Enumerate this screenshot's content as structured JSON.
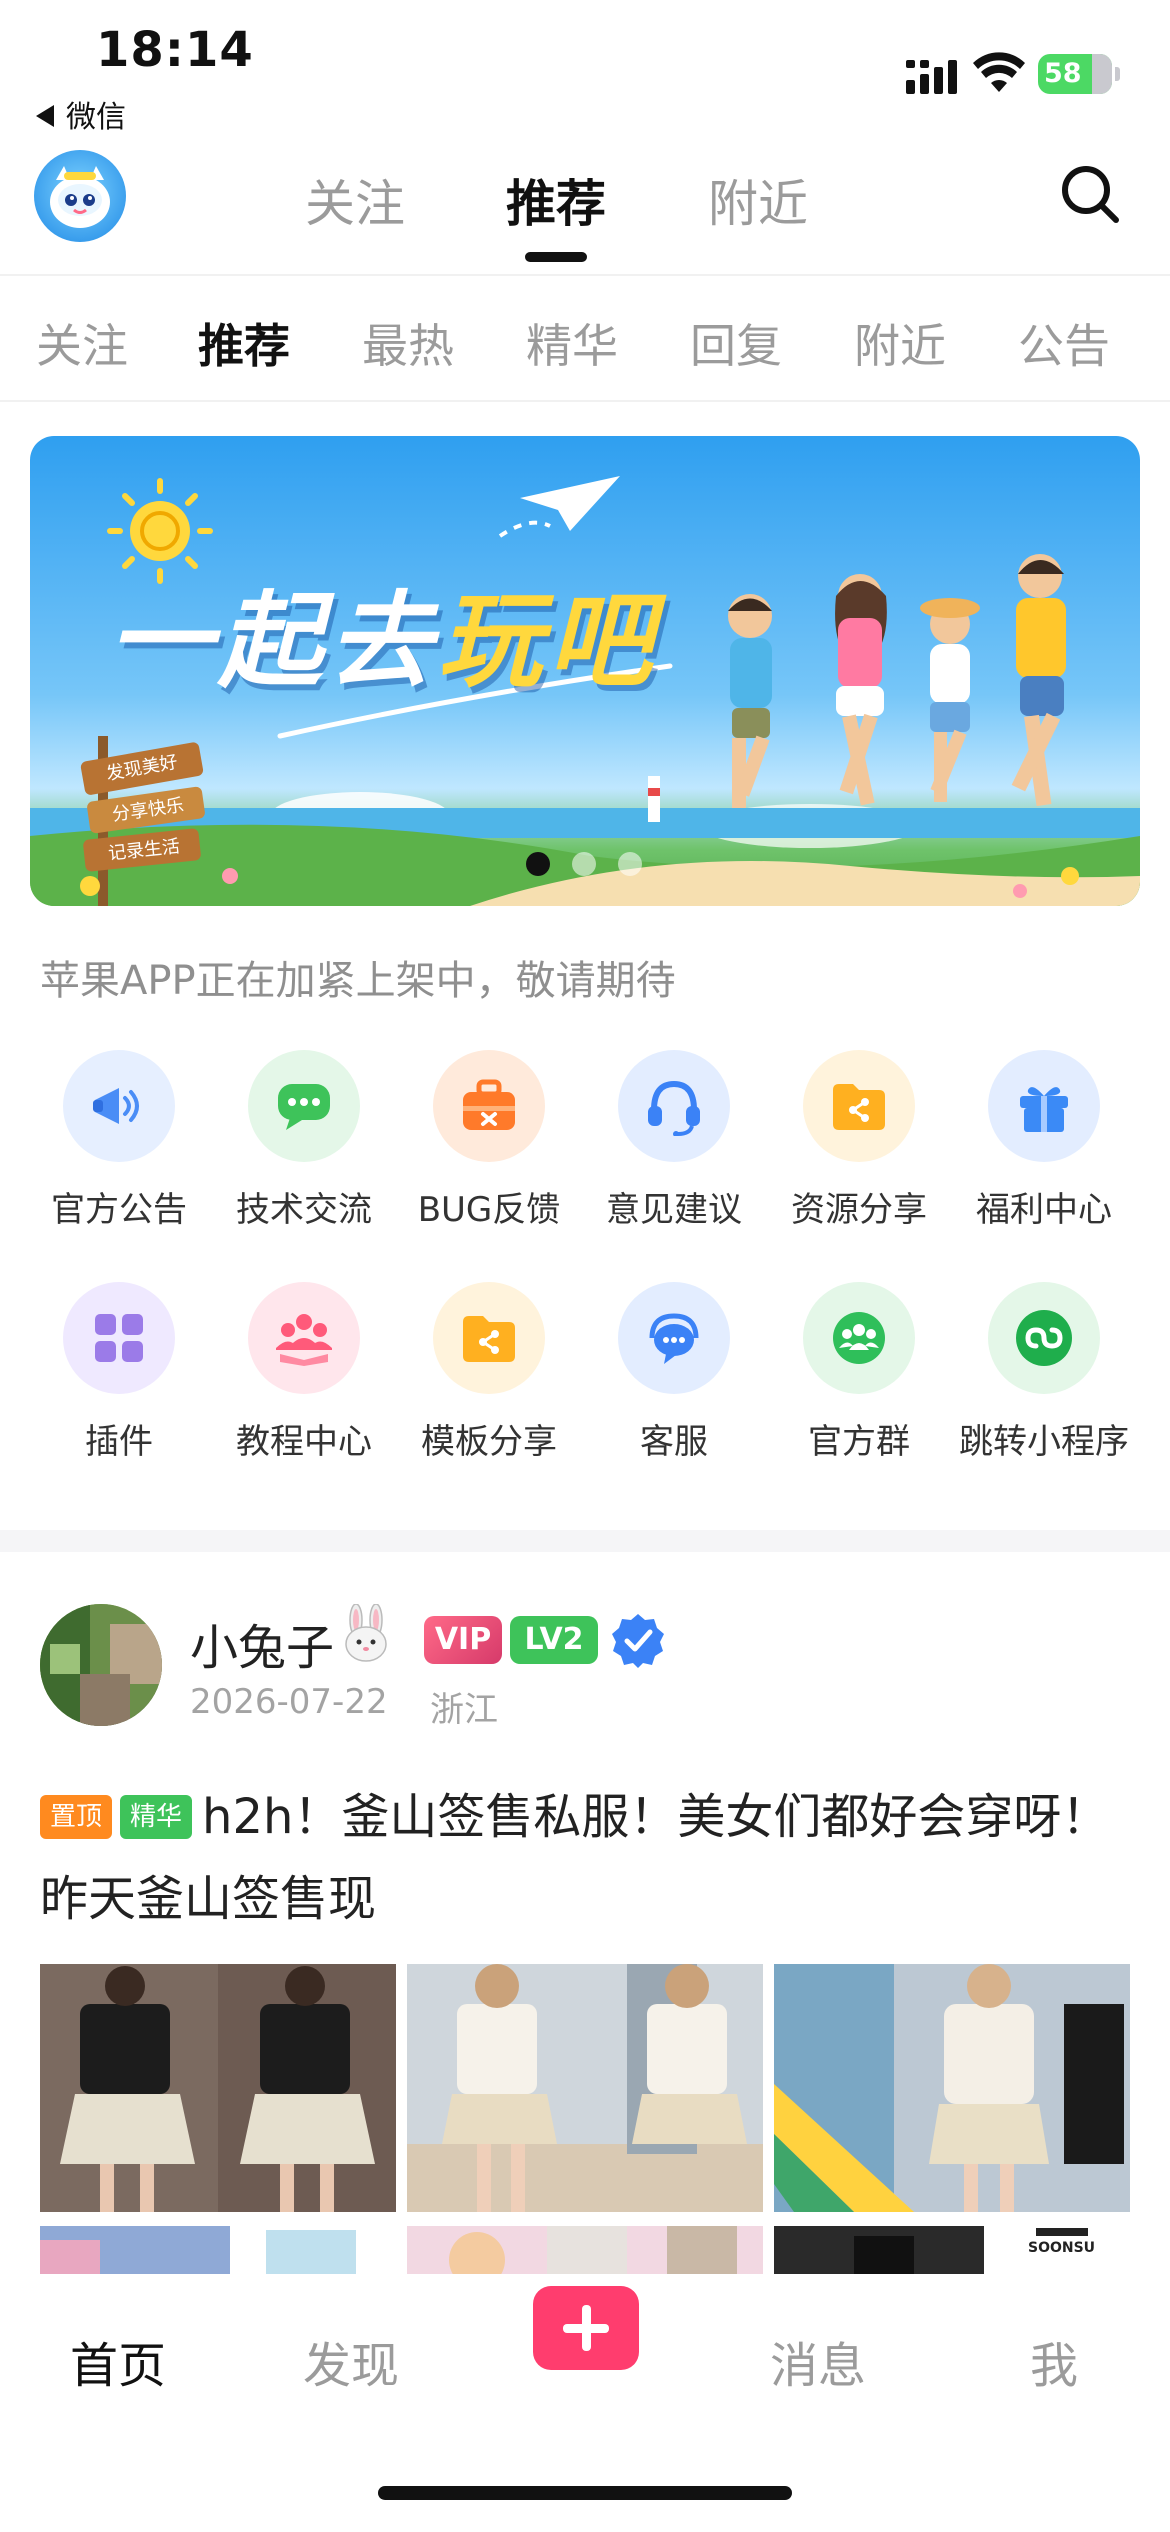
{
  "status_bar": {
    "time": "18:14",
    "back_app": "微信",
    "battery": "58"
  },
  "header": {
    "tabs": [
      {
        "label": "关注"
      },
      {
        "label": "推荐"
      },
      {
        "label": "附近"
      }
    ]
  },
  "category_tabs": [
    {
      "label": "关注"
    },
    {
      "label": "推荐"
    },
    {
      "label": "最热"
    },
    {
      "label": "精华"
    },
    {
      "label": "回复"
    },
    {
      "label": "附近"
    },
    {
      "label": "公告"
    }
  ],
  "banner": {
    "title_main": "一起去",
    "title_highlight": "玩吧",
    "signs": [
      "发现美好",
      "分享快乐",
      "记录生活"
    ],
    "page_count": 3,
    "active_page": 1
  },
  "notice": "苹果APP正在加紧上架中，敬请期待",
  "grid": [
    {
      "label": "官方公告",
      "icon": "megaphone-icon",
      "color": "#4a8df6"
    },
    {
      "label": "技术交流",
      "icon": "chat-icon",
      "color": "#3ec35a"
    },
    {
      "label": "BUG反馈",
      "icon": "toolbox-icon",
      "color": "#ff7a2a"
    },
    {
      "label": "意见建议",
      "icon": "headset-icon",
      "color": "#3b82f6"
    },
    {
      "label": "资源分享",
      "icon": "folder-share-icon",
      "color": "#ffb020"
    },
    {
      "label": "福利中心",
      "icon": "gift-icon",
      "color": "#3b8af6"
    },
    {
      "label": "插件",
      "icon": "plugin-grid-icon",
      "color": "#9b7be8"
    },
    {
      "label": "教程中心",
      "icon": "group-icon",
      "color": "#ff5a7a"
    },
    {
      "label": "模板分享",
      "icon": "folder-share-icon",
      "color": "#ffb020"
    },
    {
      "label": "客服",
      "icon": "service-chat-icon",
      "color": "#3b82f6"
    },
    {
      "label": "官方群",
      "icon": "wechat-group-icon",
      "color": "#2fbf5a"
    },
    {
      "label": "跳转小程序",
      "icon": "mini-program-icon",
      "color": "#1fae4c"
    }
  ],
  "post": {
    "username": "小兔子",
    "vip_badge": "VIP",
    "level_badge": "LV2",
    "date": "2026-07-22",
    "location": "浙江",
    "tag_top": "置顶",
    "tag_best": "精华",
    "text": "h2h！釜山签售私服！美女们都好会穿呀！ 昨天釜山签售现",
    "photo_caption": "SOONSU"
  },
  "tab_bar": {
    "items": [
      {
        "label": "首页"
      },
      {
        "label": "发现"
      },
      {
        "label": "消息"
      },
      {
        "label": "我"
      }
    ]
  }
}
